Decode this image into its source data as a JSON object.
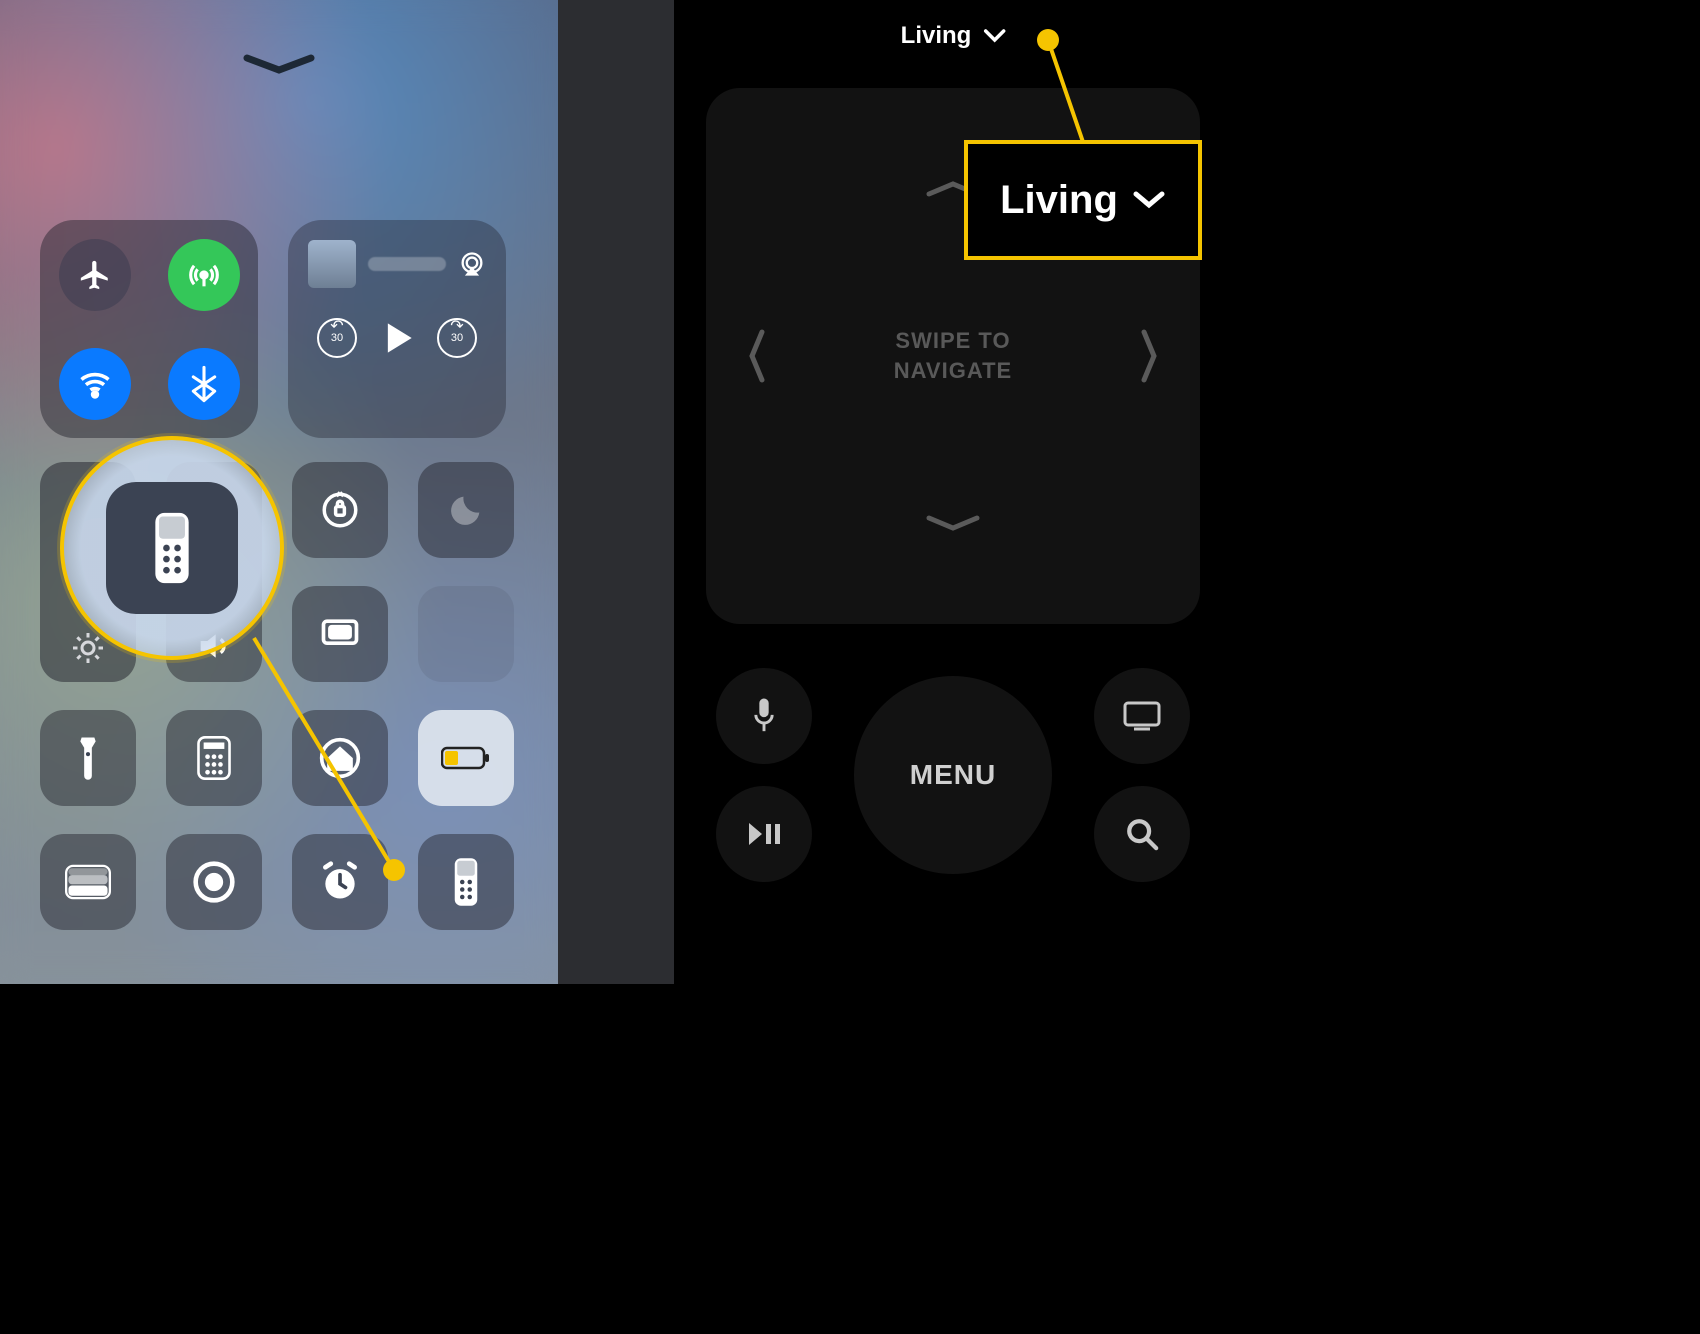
{
  "left": {
    "connectivity": {
      "airplane": "airplane-icon",
      "cellular": "cellular-icon",
      "wifi": "wifi-icon",
      "bluetooth": "bluetooth-icon"
    },
    "media": {
      "airplay": "airplay-icon",
      "back30_label": "30",
      "fwd30_label": "30"
    },
    "slider_labels": {
      "brightness": "brightness-icon",
      "volume": "volume-icon"
    },
    "tiles_row1_extra": {
      "rotation_lock": "rotation-lock-icon",
      "dnd": "moon-icon"
    },
    "tiles_row3": {
      "flashlight": "flashlight-icon",
      "calculator": "calculator-icon",
      "home": "home-icon",
      "low_power": "low-power-icon"
    },
    "tiles_row4": {
      "wallet": "wallet-icon",
      "record": "screen-record-icon",
      "alarm": "alarm-icon",
      "remote": "apple-tv-remote-icon"
    },
    "zoom_target": "apple-tv-remote-icon"
  },
  "right": {
    "device_label": "Living",
    "touchpad_hint_line1": "SWIPE TO",
    "touchpad_hint_line2": "NAVIGATE",
    "menu_label": "MENU",
    "buttons": {
      "siri": "mic-icon",
      "playpause": "play-pause-icon",
      "screen": "tv-icon",
      "search": "search-icon"
    },
    "callout_label": "Living"
  },
  "colors": {
    "accent": "#f5c400",
    "green": "#34c759",
    "blue": "#0a7aff"
  }
}
